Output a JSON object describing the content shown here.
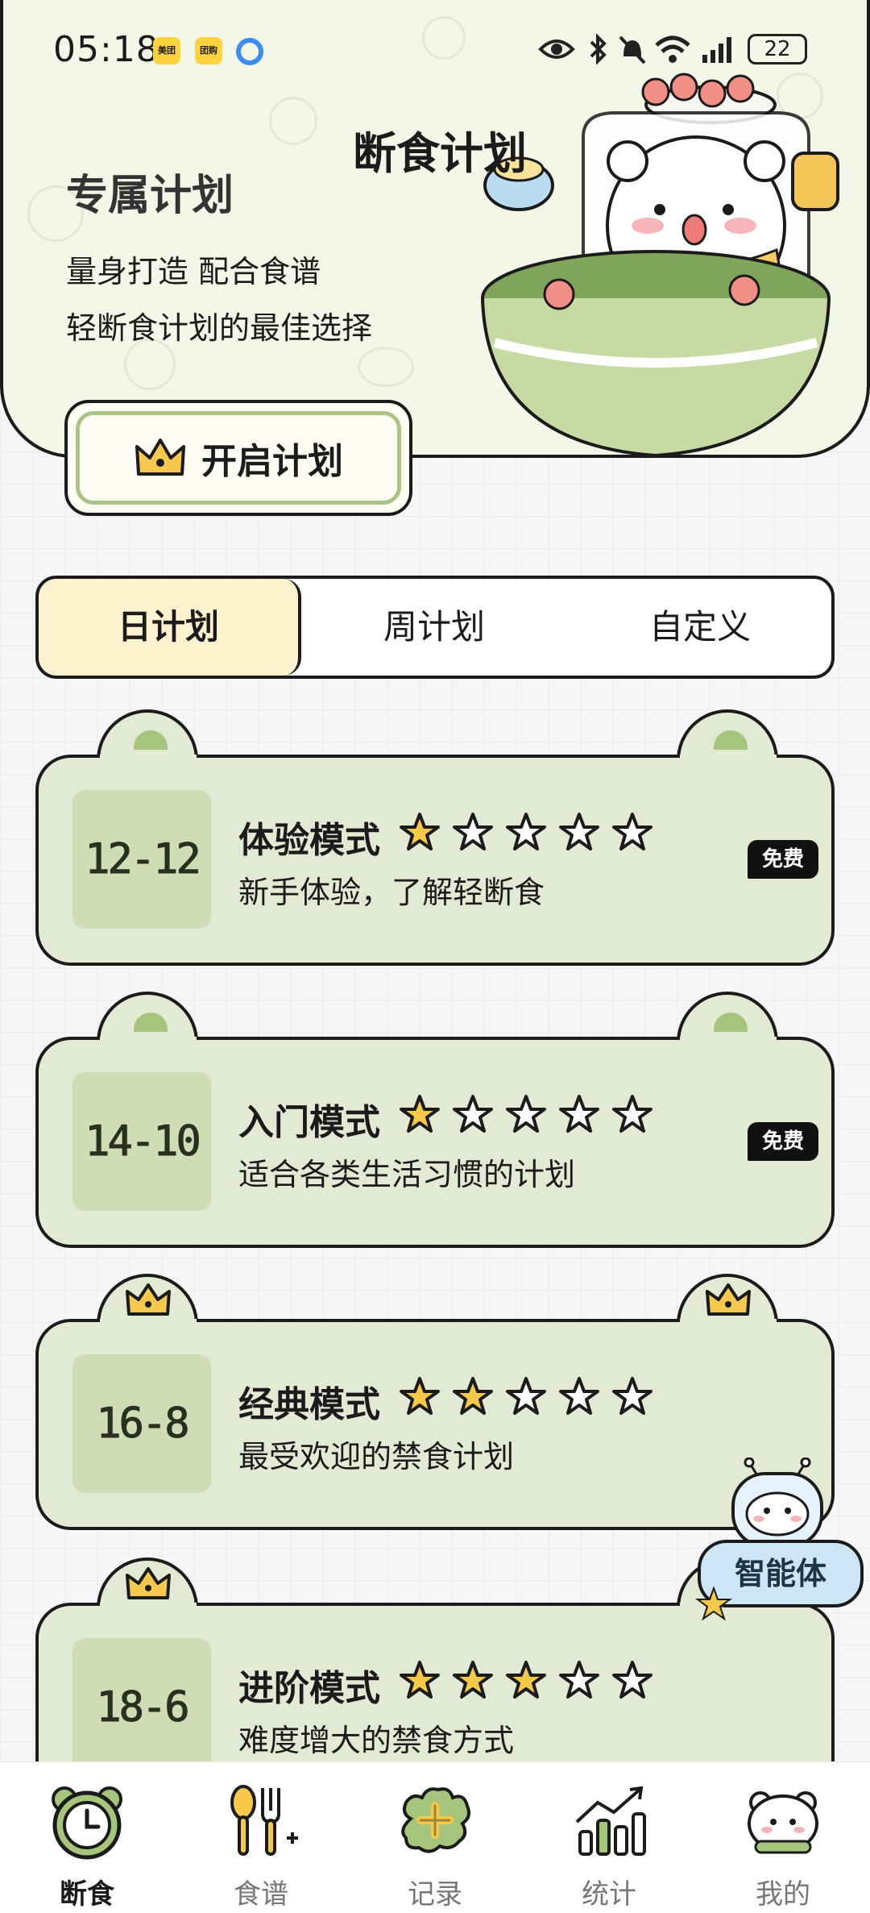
{
  "status_bar": {
    "time": "05:18",
    "app_badge_1": "美团",
    "app_badge_2": "团购",
    "battery": "22"
  },
  "header": {
    "title": "断食计划",
    "subtitle": "专属计划",
    "desc_line1": "量身打造 配合食谱",
    "desc_line2": "轻断食计划的最佳选择",
    "start_button_label": "开启计划"
  },
  "tabs": [
    {
      "label": "日计划",
      "active": true
    },
    {
      "label": "周计划",
      "active": false
    },
    {
      "label": "自定义",
      "active": false
    }
  ],
  "plans": [
    {
      "ratio": "12-12",
      "title": "体验模式",
      "stars_filled": 1,
      "stars_total": 5,
      "desc": "新手体验，了解轻断食",
      "badge": "免费",
      "ear": "dot"
    },
    {
      "ratio": "14-10",
      "title": "入门模式",
      "stars_filled": 1,
      "stars_total": 5,
      "desc": "适合各类生活习惯的计划",
      "badge": "免费",
      "ear": "dot"
    },
    {
      "ratio": "16-8",
      "title": "经典模式",
      "stars_filled": 2,
      "stars_total": 5,
      "desc": "最受欢迎的禁食计划",
      "badge": "",
      "ear": "crown"
    },
    {
      "ratio": "18-6",
      "title": "进阶模式",
      "stars_filled": 3,
      "stars_total": 5,
      "desc": "难度增大的禁食方式",
      "badge": "",
      "ear": "crown"
    }
  ],
  "agent": {
    "label": "智能体"
  },
  "bottom_nav": [
    {
      "label": "断食",
      "icon": "clock-icon",
      "active": true
    },
    {
      "label": "食谱",
      "icon": "utensils-icon",
      "active": false
    },
    {
      "label": "记录",
      "icon": "add-record-icon",
      "active": false
    },
    {
      "label": "统计",
      "icon": "chart-icon",
      "active": false
    },
    {
      "label": "我的",
      "icon": "bear-profile-icon",
      "active": false
    }
  ],
  "colors": {
    "card_bg": "#e2ead3",
    "ratio_bg": "#cfdcb4",
    "accent_green": "#a5c57c",
    "tab_active_bg": "#fff3cf",
    "star_fill": "#f7c948",
    "agent_blue": "#cde6f6"
  }
}
